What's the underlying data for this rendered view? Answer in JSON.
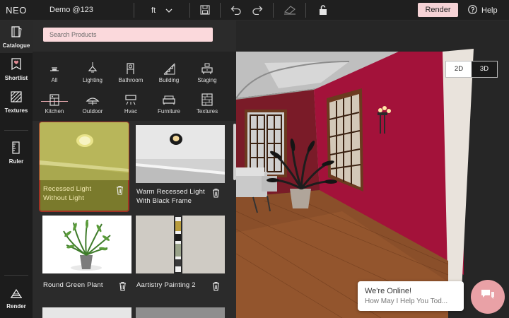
{
  "app": {
    "brand": "NEO",
    "project_name": "Demo @123",
    "unit": "ft"
  },
  "toolbar": {
    "render_label": "Render",
    "help_label": "Help"
  },
  "rail": {
    "items": [
      {
        "label": "Catalogue",
        "icon": "catalogue-icon"
      },
      {
        "label": "Shortlist",
        "icon": "shortlist-icon"
      },
      {
        "label": "Textures",
        "icon": "textures-icon"
      },
      {
        "label": "Ruler",
        "icon": "ruler-icon"
      },
      {
        "label": "Render",
        "icon": "render-icon"
      }
    ]
  },
  "search": {
    "placeholder": "Search Products",
    "value": ""
  },
  "categories": [
    {
      "label": "All",
      "icon": "lamp-icon"
    },
    {
      "label": "Lighting",
      "icon": "pendant-lamp-icon"
    },
    {
      "label": "Bathroom",
      "icon": "bathroom-icon"
    },
    {
      "label": "Building",
      "icon": "stairs-icon"
    },
    {
      "label": "Staging",
      "icon": "staging-icon"
    },
    {
      "label": "Kitchen",
      "icon": "kitchen-icon"
    },
    {
      "label": "Outdoor",
      "icon": "outdoor-icon"
    },
    {
      "label": "Hvac",
      "icon": "hvac-icon"
    },
    {
      "label": "Furniture",
      "icon": "furniture-icon"
    },
    {
      "label": "Textures",
      "icon": "texture-icon"
    }
  ],
  "products": [
    {
      "name": "Recessed Light Without Light",
      "selected": true
    },
    {
      "name": "Warm Recessed Light With Black Frame",
      "selected": false
    },
    {
      "name": "Round Green Plant",
      "selected": false
    },
    {
      "name": "Aartistry Painting 2",
      "selected": false
    }
  ],
  "view": {
    "mode_2d": "2D",
    "mode_3d": "3D",
    "active": "3D"
  },
  "chat": {
    "title": "We're Online!",
    "subtitle": "How May I Help You Tod..."
  },
  "colors": {
    "accent_pink": "#f6d3d6",
    "wall_red": "#a3123a",
    "selected_card": "#7a7a2c",
    "selected_border": "#a13223"
  }
}
